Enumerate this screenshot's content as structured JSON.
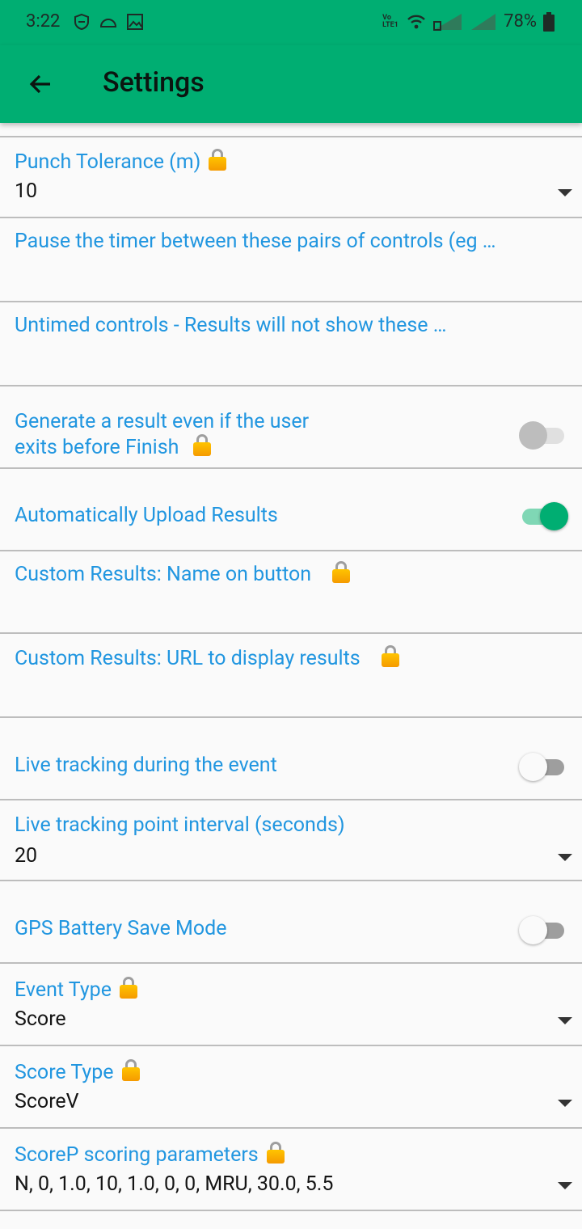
{
  "status_bar": {
    "time": "3:22",
    "volte_label": "Vo LTE1",
    "battery": "78%"
  },
  "header": {
    "title": "Settings"
  },
  "settings": {
    "punch_tolerance": {
      "label": "Punch Tolerance (m)",
      "value": "10"
    },
    "pause_timer": {
      "label": "Pause the timer between these pairs of controls (eg …"
    },
    "untimed_controls": {
      "label": "Untimed controls - Results will not show these …"
    },
    "generate_result": {
      "label_line1": "Generate a result even if the user",
      "label_line2": "exits before Finish",
      "enabled": false
    },
    "auto_upload": {
      "label": "Automatically Upload Results",
      "enabled": true
    },
    "custom_results_name": {
      "label": "Custom Results: Name on button"
    },
    "custom_results_url": {
      "label": "Custom Results: URL to display results"
    },
    "live_tracking": {
      "label": "Live tracking during the event",
      "enabled": false
    },
    "live_tracking_interval": {
      "label": "Live tracking point interval (seconds)",
      "value": "20"
    },
    "gps_battery_save": {
      "label": "GPS Battery Save Mode",
      "enabled": false
    },
    "event_type": {
      "label": "Event Type",
      "value": "Score"
    },
    "score_type": {
      "label": "Score Type",
      "value": "ScoreV"
    },
    "scorep_params": {
      "label": "ScoreP scoring parameters",
      "value": "N, 0, 1.0, 10, 1.0, 0, 0, MRU, 30.0, 5.5"
    }
  },
  "colors": {
    "accent": "#00ae72",
    "label_blue": "#2196e0",
    "toggle_on": "#00ae72"
  }
}
